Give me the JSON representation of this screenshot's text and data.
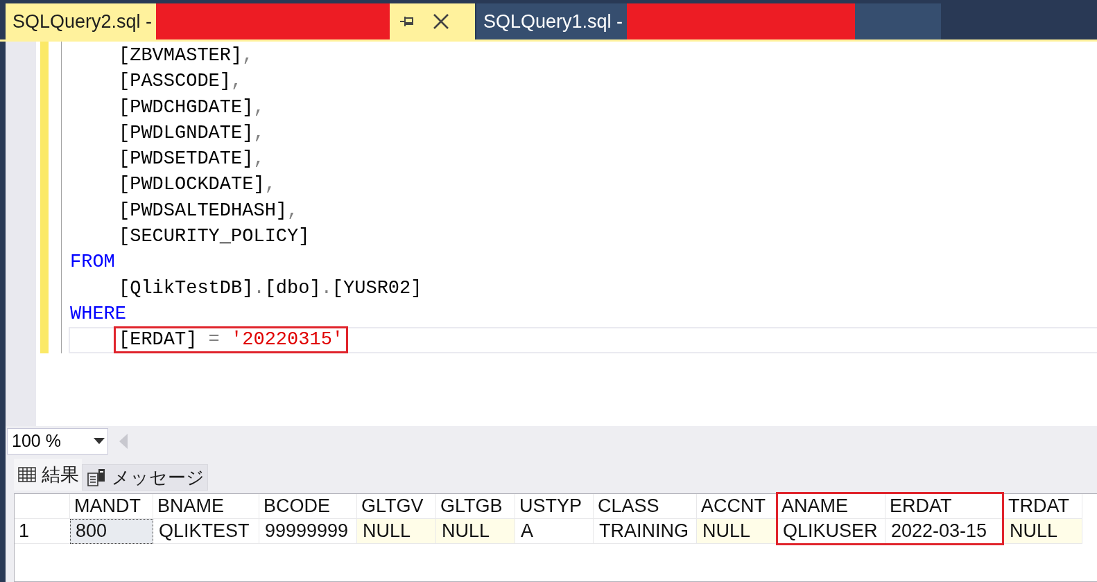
{
  "tabs": [
    {
      "title": "SQLQuery2.sql -",
      "selected": true,
      "redacted": true
    },
    {
      "title": "SQLQuery1.sql -",
      "selected": false,
      "redacted": true
    }
  ],
  "editor": {
    "lines": [
      {
        "boxed": false,
        "tokens": [
          {
            "kind": "ident",
            "text": "[ZBVMASTER]"
          },
          {
            "kind": "punct",
            "text": ","
          }
        ]
      },
      {
        "boxed": false,
        "tokens": [
          {
            "kind": "ident",
            "text": "[PASSCODE]"
          },
          {
            "kind": "punct",
            "text": ","
          }
        ]
      },
      {
        "boxed": false,
        "tokens": [
          {
            "kind": "ident",
            "text": "[PWDCHGDATE]"
          },
          {
            "kind": "punct",
            "text": ","
          }
        ]
      },
      {
        "boxed": false,
        "tokens": [
          {
            "kind": "ident",
            "text": "[PWDLGNDATE]"
          },
          {
            "kind": "punct",
            "text": ","
          }
        ]
      },
      {
        "boxed": false,
        "tokens": [
          {
            "kind": "ident",
            "text": "[PWDSETDATE]"
          },
          {
            "kind": "punct",
            "text": ","
          }
        ]
      },
      {
        "boxed": false,
        "tokens": [
          {
            "kind": "ident",
            "text": "[PWDLOCKDATE]"
          },
          {
            "kind": "punct",
            "text": ","
          }
        ]
      },
      {
        "boxed": false,
        "tokens": [
          {
            "kind": "ident",
            "text": "[PWDSALTEDHASH]"
          },
          {
            "kind": "punct",
            "text": ","
          }
        ]
      },
      {
        "boxed": false,
        "tokens": [
          {
            "kind": "ident",
            "text": "[SECURITY_POLICY]"
          }
        ]
      },
      {
        "boxed": false,
        "tokens": [
          {
            "kind": "keyword",
            "text": "FROM"
          }
        ]
      },
      {
        "boxed": false,
        "tokens": [
          {
            "kind": "ident",
            "text": "[QlikTestDB]"
          },
          {
            "kind": "punct",
            "text": "."
          },
          {
            "kind": "ident",
            "text": "[dbo]"
          },
          {
            "kind": "punct",
            "text": "."
          },
          {
            "kind": "ident",
            "text": "[YUSR02]"
          }
        ]
      },
      {
        "boxed": false,
        "tokens": [
          {
            "kind": "keyword",
            "text": "WHERE"
          }
        ]
      },
      {
        "boxed": true,
        "tokens": [
          {
            "kind": "ident",
            "text": "[ERDAT]"
          },
          {
            "kind": "punct",
            "text": " = "
          },
          {
            "kind": "string",
            "text": "'20220315'"
          }
        ]
      }
    ]
  },
  "zoom": {
    "value": "100 %"
  },
  "result_tabs": [
    {
      "label": "結果",
      "selected": true
    },
    {
      "label": "メッセージ",
      "selected": false
    }
  ],
  "results": {
    "columns": [
      {
        "name": "MANDT",
        "boxed": false
      },
      {
        "name": "BNAME",
        "boxed": false
      },
      {
        "name": "BCODE",
        "boxed": false
      },
      {
        "name": "GLTGV",
        "boxed": false
      },
      {
        "name": "GLTGB",
        "boxed": false
      },
      {
        "name": "USTYP",
        "boxed": false
      },
      {
        "name": "CLASS",
        "boxed": false
      },
      {
        "name": "ACCNT",
        "boxed": false
      },
      {
        "name": "ANAME",
        "boxed": true
      },
      {
        "name": "ERDAT",
        "boxed": true
      },
      {
        "name": "TRDAT",
        "boxed": false
      }
    ],
    "rows": [
      {
        "number": "1",
        "cells": [
          {
            "text": "800",
            "null": false,
            "selected": true
          },
          {
            "text": "QLIKTEST",
            "null": false,
            "selected": false
          },
          {
            "text": "99999999",
            "null": false,
            "selected": false
          },
          {
            "text": "NULL",
            "null": true,
            "selected": false
          },
          {
            "text": "NULL",
            "null": true,
            "selected": false
          },
          {
            "text": "A",
            "null": false,
            "selected": false
          },
          {
            "text": "TRAINING",
            "null": false,
            "selected": false
          },
          {
            "text": "NULL",
            "null": true,
            "selected": false
          },
          {
            "text": "QLIKUSER",
            "null": false,
            "selected": false
          },
          {
            "text": "2022-03-15",
            "null": false,
            "selected": false
          },
          {
            "text": "NULL",
            "null": true,
            "selected": false
          }
        ]
      }
    ]
  }
}
